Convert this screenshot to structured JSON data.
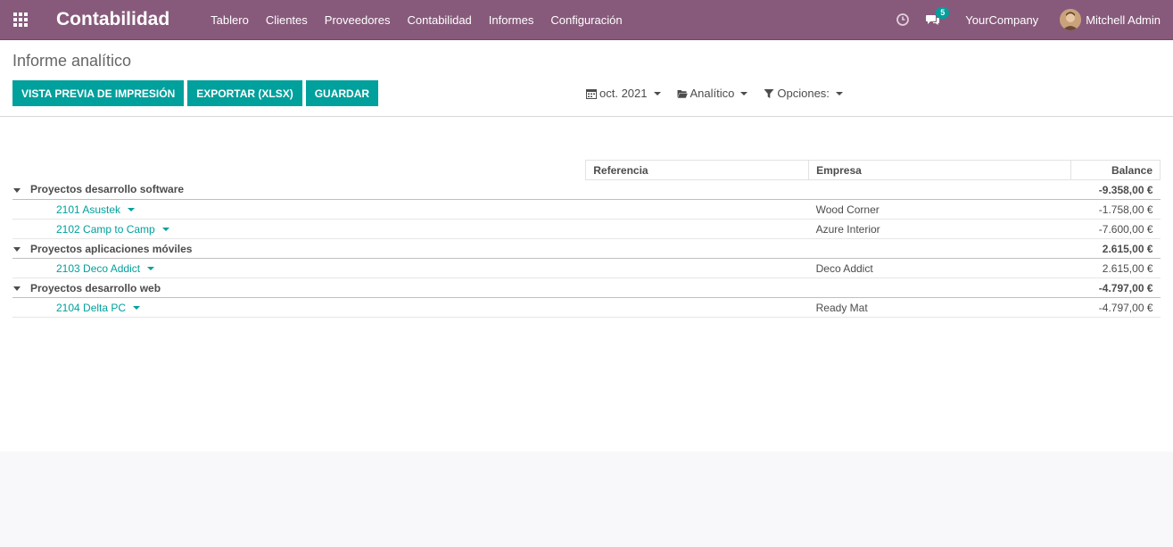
{
  "navbar": {
    "brand": "Contabilidad",
    "menu": [
      "Tablero",
      "Clientes",
      "Proveedores",
      "Contabilidad",
      "Informes",
      "Configuración"
    ],
    "chat_count": "5",
    "company": "YourCompany",
    "user": "Mitchell Admin",
    "accent_color": "#875a7b"
  },
  "panel": {
    "title": "Informe analítico",
    "buttons": [
      "VISTA PREVIA DE IMPRESIÓN",
      "EXPORTAR (XLSX)",
      "GUARDAR"
    ],
    "filters": {
      "date": "oct. 2021",
      "analytic": "Analítico",
      "options": "Opciones:"
    },
    "button_color": "#00a09d"
  },
  "report": {
    "headers": {
      "reference": "Referencia",
      "partner": "Empresa",
      "balance": "Balance"
    },
    "groups": [
      {
        "name": "Proyectos desarrollo software",
        "balance": "-9.358,00 €",
        "lines": [
          {
            "account": "2101 Asustek",
            "partner": "Wood Corner",
            "balance": "-1.758,00 €"
          },
          {
            "account": "2102 Camp to Camp",
            "partner": "Azure Interior",
            "balance": "-7.600,00 €"
          }
        ]
      },
      {
        "name": "Proyectos aplicaciones móviles",
        "balance": "2.615,00 €",
        "lines": [
          {
            "account": "2103 Deco Addict",
            "partner": "Deco Addict",
            "balance": "2.615,00 €"
          }
        ]
      },
      {
        "name": "Proyectos desarrollo web",
        "balance": "-4.797,00 €",
        "lines": [
          {
            "account": "2104 Delta PC",
            "partner": "Ready Mat",
            "balance": "-4.797,00 €"
          }
        ]
      }
    ]
  }
}
